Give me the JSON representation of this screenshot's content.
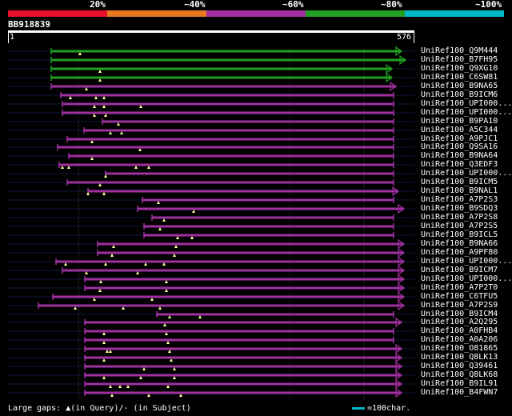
{
  "legend": {
    "labels": [
      "20%",
      "~40%",
      "~60%",
      "~80%",
      "~100%"
    ],
    "colors": [
      "#e8102a",
      "#e87820",
      "#a030a0",
      "#22a022",
      "#00b8c8"
    ]
  },
  "query": {
    "id": "BB918839",
    "start": "1",
    "end": "576"
  },
  "hits": [
    {
      "label": "UniRef100_Q9M444",
      "color": "#22a022",
      "start": 64,
      "end": 502,
      "arrow": true,
      "marks": [
        100
      ]
    },
    {
      "label": "UniRef100_B7FH95",
      "color": "#22a022",
      "start": 64,
      "end": 507,
      "arrow": true,
      "marks": []
    },
    {
      "label": "UniRef100_Q9XG10",
      "color": "#22a022",
      "start": 64,
      "end": 490,
      "arrow": true,
      "marks": [
        125
      ]
    },
    {
      "label": "UniRef100_C6SW81",
      "color": "#22a022",
      "start": 64,
      "end": 490,
      "arrow": true,
      "marks": [
        125
      ]
    },
    {
      "label": "UniRef100_B9NA65",
      "color": "#a030a0",
      "start": 64,
      "end": 495,
      "arrow": true,
      "marks": [
        108
      ]
    },
    {
      "label": "UniRef100_B9ICM6",
      "color": "#a030a0",
      "start": 76,
      "end": 492,
      "arrow": false,
      "marks": [
        88,
        120,
        130
      ]
    },
    {
      "label": "UniRef100_UPI000...",
      "color": "#a030a0",
      "start": 78,
      "end": 492,
      "arrow": false,
      "marks": [
        118,
        130,
        176
      ]
    },
    {
      "label": "UniRef100_UPI000...",
      "color": "#a030a0",
      "start": 78,
      "end": 492,
      "arrow": false,
      "marks": [
        118,
        132
      ]
    },
    {
      "label": "UniRef100_B9PA10",
      "color": "#a030a0",
      "start": 128,
      "end": 492,
      "arrow": false,
      "marks": [
        148
      ]
    },
    {
      "label": "UniRef100_A5C344",
      "color": "#a030a0",
      "start": 105,
      "end": 492,
      "arrow": false,
      "marks": [
        138,
        152
      ]
    },
    {
      "label": "UniRef100_A9PJC1",
      "color": "#a030a0",
      "start": 84,
      "end": 492,
      "arrow": false,
      "marks": [
        115
      ]
    },
    {
      "label": "UniRef100_Q9SA16",
      "color": "#a030a0",
      "start": 72,
      "end": 492,
      "arrow": false,
      "marks": [
        175
      ]
    },
    {
      "label": "UniRef100_B9NA64",
      "color": "#a030a0",
      "start": 86,
      "end": 492,
      "arrow": false,
      "marks": [
        115
      ]
    },
    {
      "label": "UniRef100_Q3EDF3",
      "color": "#a030a0",
      "start": 74,
      "end": 492,
      "arrow": false,
      "marks": [
        78,
        86,
        170,
        186
      ]
    },
    {
      "label": "UniRef100_UPI000...",
      "color": "#a030a0",
      "start": 132,
      "end": 492,
      "arrow": false,
      "marks": [
        132
      ]
    },
    {
      "label": "UniRef100_B9ICM5",
      "color": "#a030a0",
      "start": 84,
      "end": 492,
      "arrow": false,
      "marks": [
        125
      ]
    },
    {
      "label": "UniRef100_B9NAL1",
      "color": "#a030a0",
      "start": 110,
      "end": 498,
      "arrow": true,
      "marks": [
        110,
        130
      ]
    },
    {
      "label": "UniRef100_A7P2S3",
      "color": "#a030a0",
      "start": 178,
      "end": 492,
      "arrow": false,
      "marks": [
        198
      ]
    },
    {
      "label": "UniRef100_B9SDQ3",
      "color": "#a030a0",
      "start": 172,
      "end": 505,
      "arrow": true,
      "marks": [
        242
      ]
    },
    {
      "label": "UniRef100_A7P2S8",
      "color": "#a030a0",
      "start": 190,
      "end": 492,
      "arrow": false,
      "marks": [
        205
      ]
    },
    {
      "label": "UniRef100_A7P2S5",
      "color": "#a030a0",
      "start": 180,
      "end": 492,
      "arrow": false,
      "marks": [
        200
      ]
    },
    {
      "label": "UniRef100_B9ICL5",
      "color": "#a030a0",
      "start": 180,
      "end": 492,
      "arrow": false,
      "marks": [
        222,
        240
      ]
    },
    {
      "label": "UniRef100_B9NA66",
      "color": "#a030a0",
      "start": 122,
      "end": 505,
      "arrow": true,
      "marks": [
        142,
        220
      ]
    },
    {
      "label": "UniRef100_A9PF80",
      "color": "#a030a0",
      "start": 122,
      "end": 505,
      "arrow": true,
      "marks": [
        140,
        218
      ]
    },
    {
      "label": "UniRef100_UPI000...",
      "color": "#a030a0",
      "start": 70,
      "end": 505,
      "arrow": true,
      "marks": [
        82,
        132,
        182,
        205
      ]
    },
    {
      "label": "UniRef100_B9ICM7",
      "color": "#a030a0",
      "start": 78,
      "end": 505,
      "arrow": true,
      "marks": [
        108,
        172
      ]
    },
    {
      "label": "UniRef100_UPI000...",
      "color": "#a030a0",
      "start": 106,
      "end": 505,
      "arrow": true,
      "marks": [
        126,
        208
      ]
    },
    {
      "label": "UniRef100_A7P2T0",
      "color": "#a030a0",
      "start": 106,
      "end": 505,
      "arrow": true,
      "marks": [
        125,
        208
      ]
    },
    {
      "label": "UniRef100_C6TFU5",
      "color": "#a030a0",
      "start": 66,
      "end": 505,
      "arrow": true,
      "marks": [
        118,
        190
      ]
    },
    {
      "label": "UniRef100_A7P2S9",
      "color": "#a030a0",
      "start": 48,
      "end": 505,
      "arrow": true,
      "marks": [
        94,
        154,
        200
      ]
    },
    {
      "label": "UniRef100_B9ICM4",
      "color": "#a030a0",
      "start": 196,
      "end": 492,
      "arrow": false,
      "marks": [
        212,
        250
      ]
    },
    {
      "label": "UniRef100_A2Q295",
      "color": "#a030a0",
      "start": 106,
      "end": 502,
      "arrow": true,
      "marks": [
        206
      ]
    },
    {
      "label": "UniRef100_A0FHB4",
      "color": "#a030a0",
      "start": 106,
      "end": 492,
      "arrow": false,
      "marks": [
        130,
        208
      ]
    },
    {
      "label": "UniRef100_A0A206",
      "color": "#a030a0",
      "start": 106,
      "end": 492,
      "arrow": false,
      "marks": [
        130,
        210
      ]
    },
    {
      "label": "UniRef100_O81865",
      "color": "#a030a0",
      "start": 106,
      "end": 502,
      "arrow": true,
      "marks": [
        134,
        138,
        212
      ]
    },
    {
      "label": "UniRef100_Q8LK13",
      "color": "#a030a0",
      "start": 106,
      "end": 502,
      "arrow": true,
      "marks": [
        130,
        214
      ]
    },
    {
      "label": "UniRef100_Q39461",
      "color": "#a030a0",
      "start": 106,
      "end": 502,
      "arrow": true,
      "marks": [
        180,
        218
      ]
    },
    {
      "label": "UniRef100_Q8LK68",
      "color": "#a030a0",
      "start": 106,
      "end": 502,
      "arrow": true,
      "marks": [
        130,
        176,
        218
      ]
    },
    {
      "label": "UniRef100_B9IL91",
      "color": "#a030a0",
      "start": 106,
      "end": 502,
      "arrow": true,
      "marks": [
        138,
        150,
        160,
        210
      ]
    },
    {
      "label": "UniRef100_B4FWN7",
      "color": "#a030a0",
      "start": 106,
      "end": 502,
      "arrow": true,
      "marks": [
        140,
        186,
        226
      ]
    }
  ],
  "footer": {
    "text": "Large gaps: ▲(in Query)/- (in Subject)",
    "scale_text": "=100char.",
    "scale_color": "#00b8c8"
  }
}
